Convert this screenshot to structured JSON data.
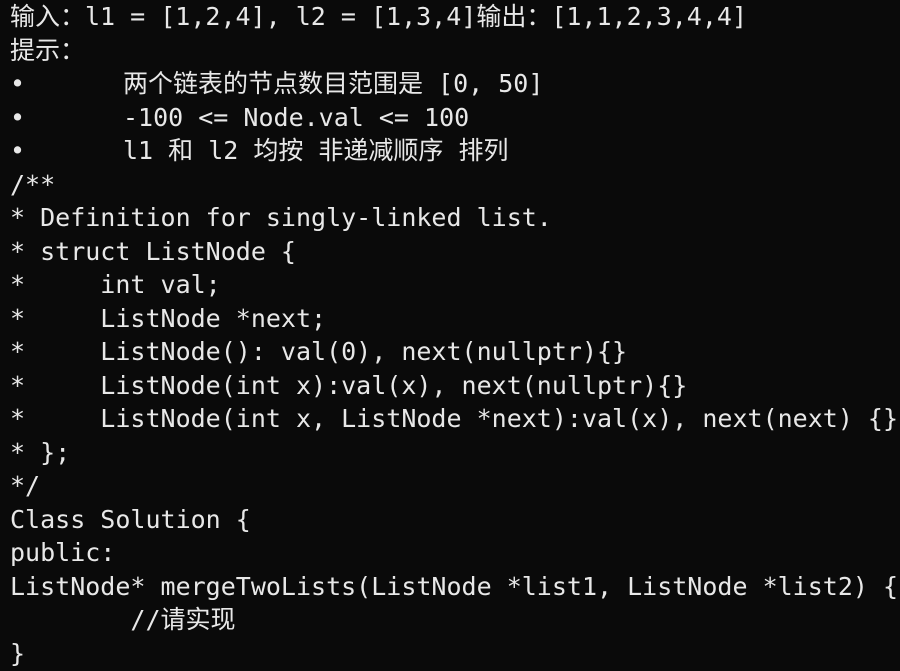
{
  "editor": {
    "lines": {
      "example_io": "输入：l1 = [1,2,4], l2 = [1,3,4]输出：[1,1,2,3,4,4]",
      "hint_heading": "提示：",
      "bullet_char": "•",
      "hint_1": "两个链表的节点数目范围是 [0, 50]",
      "hint_2": "-100 <= Node.val <= 100",
      "hint_3": "l1 和 l2 均按 非递减顺序 排列",
      "comment_open": "/**",
      "def_comment": "* Definition for singly-linked list.",
      "struct_decl": "* struct ListNode {",
      "field_val": "*     int val;",
      "field_next": "*     ListNode *next;",
      "ctor_default": "*     ListNode(): val(0), next(nullptr){}",
      "ctor_int": "*     ListNode(int x):val(x), next(nullptr){}",
      "ctor_full": "*     ListNode(int x, ListNode *next):val(x), next(next) {}",
      "struct_close": "* };",
      "comment_close": "*/",
      "class_decl": "Class Solution {",
      "access_public": "public:",
      "method_sig": "ListNode* mergeTwoLists(ListNode *list1, ListNode *list2) {",
      "todo_comment": "        //请实现",
      "class_close": "}"
    }
  }
}
